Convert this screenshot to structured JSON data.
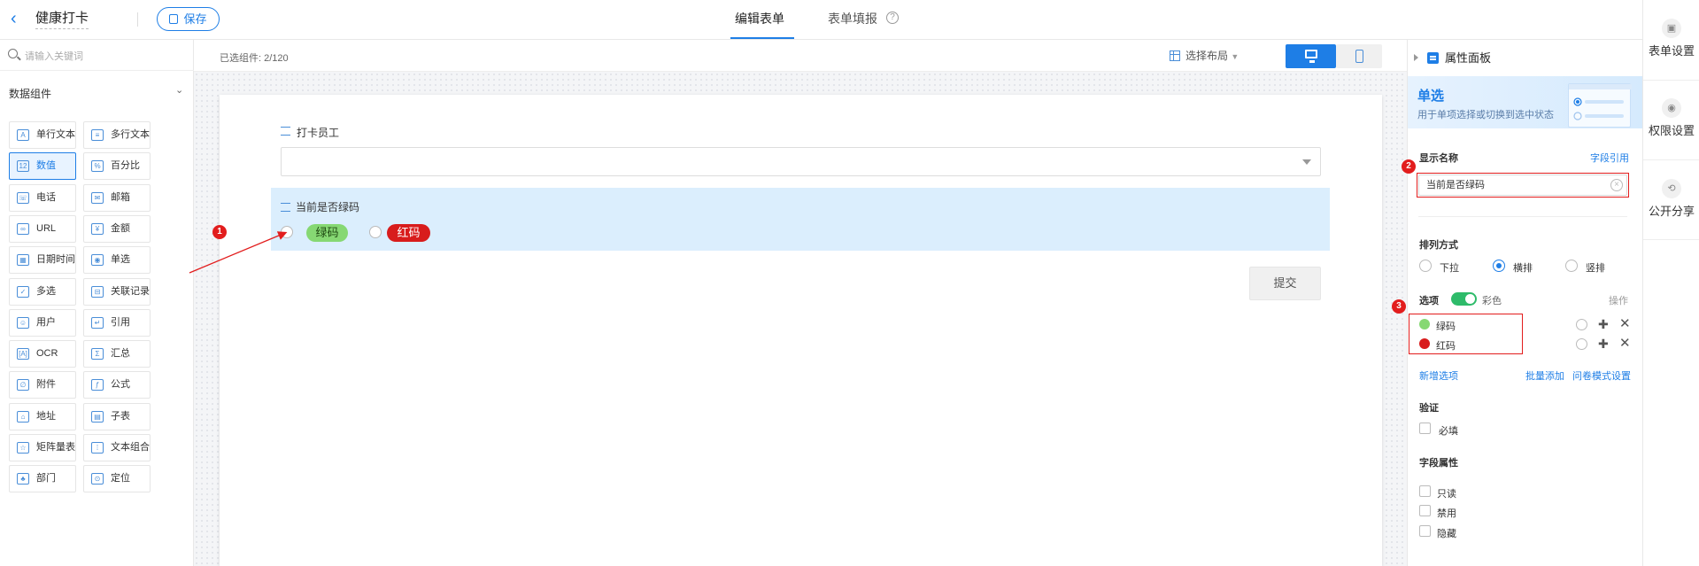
{
  "topbar": {
    "app_title": "健康打卡",
    "save_label": "保存",
    "tabs": [
      {
        "label": "编辑表单",
        "active": true
      },
      {
        "label": "表单填报",
        "active": false
      }
    ]
  },
  "left_panel": {
    "search_placeholder": "请输入关键词",
    "group_title": "数据组件",
    "components": [
      {
        "label": "单行文本",
        "icon": "text-line-icon"
      },
      {
        "label": "多行文本",
        "icon": "text-multiline-icon"
      },
      {
        "label": "数值",
        "icon": "number-icon",
        "selected": true
      },
      {
        "label": "百分比",
        "icon": "percent-icon"
      },
      {
        "label": "电话",
        "icon": "phone-icon"
      },
      {
        "label": "邮箱",
        "icon": "mail-icon"
      },
      {
        "label": "URL",
        "icon": "link-icon"
      },
      {
        "label": "金额",
        "icon": "currency-icon"
      },
      {
        "label": "日期时间",
        "icon": "calendar-icon"
      },
      {
        "label": "单选",
        "icon": "radio-icon"
      },
      {
        "label": "多选",
        "icon": "checkbox-icon"
      },
      {
        "label": "关联记录",
        "icon": "relation-icon"
      },
      {
        "label": "用户",
        "icon": "user-icon"
      },
      {
        "label": "引用",
        "icon": "quote-icon"
      },
      {
        "label": "OCR",
        "icon": "ocr-icon"
      },
      {
        "label": "汇总",
        "icon": "summary-icon"
      },
      {
        "label": "附件",
        "icon": "attachment-icon"
      },
      {
        "label": "公式",
        "icon": "formula-icon"
      },
      {
        "label": "地址",
        "icon": "location-icon"
      },
      {
        "label": "子表",
        "icon": "subtable-icon"
      },
      {
        "label": "矩阵量表",
        "icon": "matrix-icon"
      },
      {
        "label": "文本组合",
        "icon": "text-combine-icon"
      },
      {
        "label": "部门",
        "icon": "department-icon"
      },
      {
        "label": "定位",
        "icon": "pin-icon"
      }
    ]
  },
  "canvas": {
    "selected_count_label": "已选组件:",
    "selected_count_value": "2/120",
    "layout_select_label": "选择布局",
    "fields": {
      "employee": {
        "label": "打卡员工"
      },
      "green_code": {
        "label": "当前是否绿码",
        "options": [
          {
            "label": "绿码",
            "color": "#86d873",
            "text_color": "#1f4a12"
          },
          {
            "label": "红码",
            "color": "#d81c1c",
            "text_color": "#ffffff"
          }
        ]
      }
    },
    "submit_label": "提交",
    "annotations": [
      "1",
      "2",
      "3"
    ]
  },
  "right_panel": {
    "title": "属性面板",
    "banner_title": "单选",
    "banner_desc": "用于单项选择或切换到选中状态",
    "display_name_label": "显示名称",
    "field_ref_link": "字段引用",
    "display_name_value": "当前是否绿码",
    "arrange_label": "排列方式",
    "arrange_options": [
      {
        "label": "下拉",
        "checked": false
      },
      {
        "label": "横排",
        "checked": true
      },
      {
        "label": "竖排",
        "checked": false
      }
    ],
    "options_label": "选项",
    "color_toggle_label": "彩色",
    "ops_label": "操作",
    "options": [
      {
        "label": "绿码",
        "color": "#86d873"
      },
      {
        "label": "红码",
        "color": "#d81c1c"
      }
    ],
    "add_option": "新增选项",
    "batch_add": "批量添加",
    "survey_mode": "问卷模式设置",
    "validation_label": "验证",
    "required_label": "必填",
    "field_attr_label": "字段属性",
    "attr_options": [
      "只读",
      "禁用",
      "隐藏"
    ]
  },
  "far_right": {
    "items": [
      {
        "label": "表单设置",
        "icon": "form-settings-icon"
      },
      {
        "label": "权限设置",
        "icon": "permission-icon"
      },
      {
        "label": "公开分享",
        "icon": "share-icon"
      }
    ]
  },
  "colors": {
    "accent": "#1e7ee6",
    "annotation_red": "#e21d1d",
    "toggle_green": "#2ebb6a",
    "selected_field_bg": "#dbeefd"
  }
}
